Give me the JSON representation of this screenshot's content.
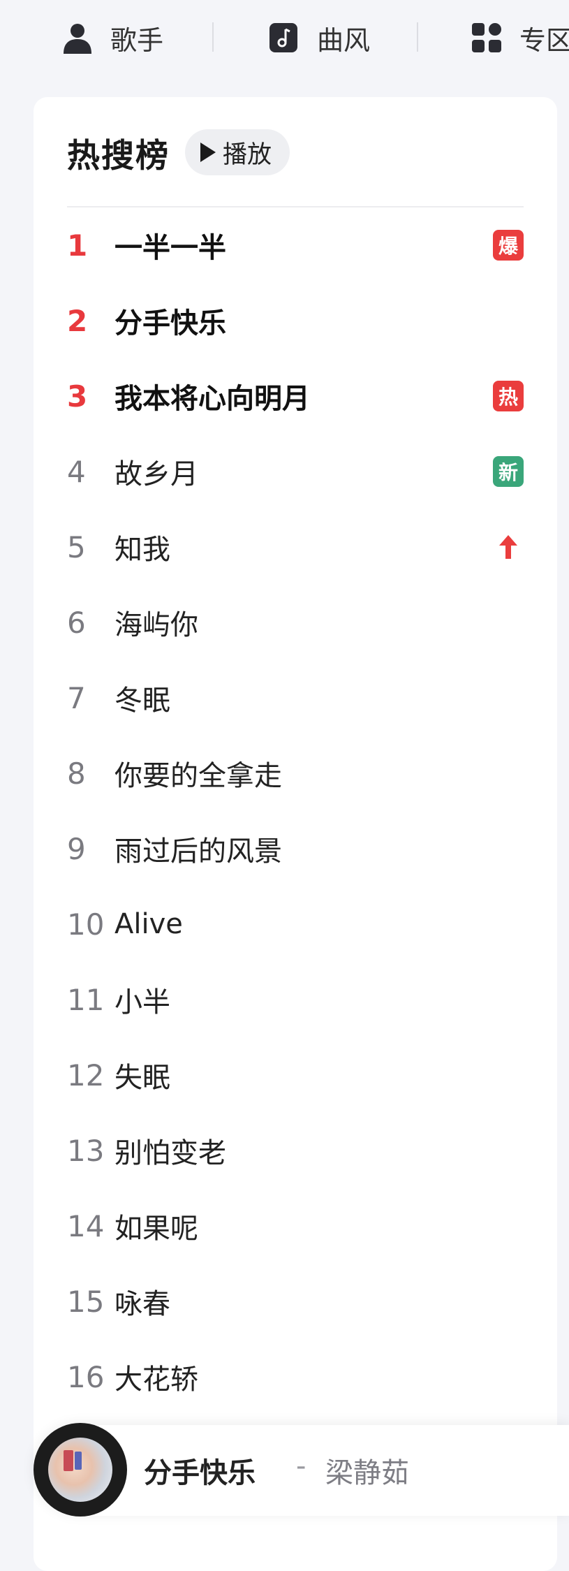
{
  "nav": {
    "items": [
      {
        "label": "歌手",
        "icon": "person-icon"
      },
      {
        "label": "曲风",
        "icon": "music-note-icon"
      },
      {
        "label": "专区",
        "icon": "grid-icon"
      }
    ]
  },
  "hot": {
    "title": "热搜榜",
    "play_label": "播放",
    "items": [
      {
        "rank": "1",
        "title": "一半一半",
        "badge": "爆"
      },
      {
        "rank": "2",
        "title": "分手快乐",
        "badge": ""
      },
      {
        "rank": "3",
        "title": "我本将心向明月",
        "badge": "热"
      },
      {
        "rank": "4",
        "title": "故乡月",
        "badge": "新"
      },
      {
        "rank": "5",
        "title": "知我",
        "badge": "up-arrow"
      },
      {
        "rank": "6",
        "title": "海屿你",
        "badge": ""
      },
      {
        "rank": "7",
        "title": "冬眠",
        "badge": ""
      },
      {
        "rank": "8",
        "title": "你要的全拿走",
        "badge": ""
      },
      {
        "rank": "9",
        "title": "雨过后的风景",
        "badge": ""
      },
      {
        "rank": "10",
        "title": "Alive",
        "badge": ""
      },
      {
        "rank": "11",
        "title": "小半",
        "badge": ""
      },
      {
        "rank": "12",
        "title": "失眠",
        "badge": ""
      },
      {
        "rank": "13",
        "title": "别怕变老",
        "badge": ""
      },
      {
        "rank": "14",
        "title": "如果呢",
        "badge": ""
      },
      {
        "rank": "15",
        "title": "咏春",
        "badge": ""
      },
      {
        "rank": "16",
        "title": "大花轿",
        "badge": ""
      }
    ]
  },
  "player": {
    "title": "分手快乐",
    "separator": "-",
    "artist": "梁静茹"
  },
  "colors": {
    "accent_red": "#e8393d",
    "badge_red": "#ea3d3d",
    "badge_green": "#3aa67a",
    "background": "#f4f5f9"
  }
}
